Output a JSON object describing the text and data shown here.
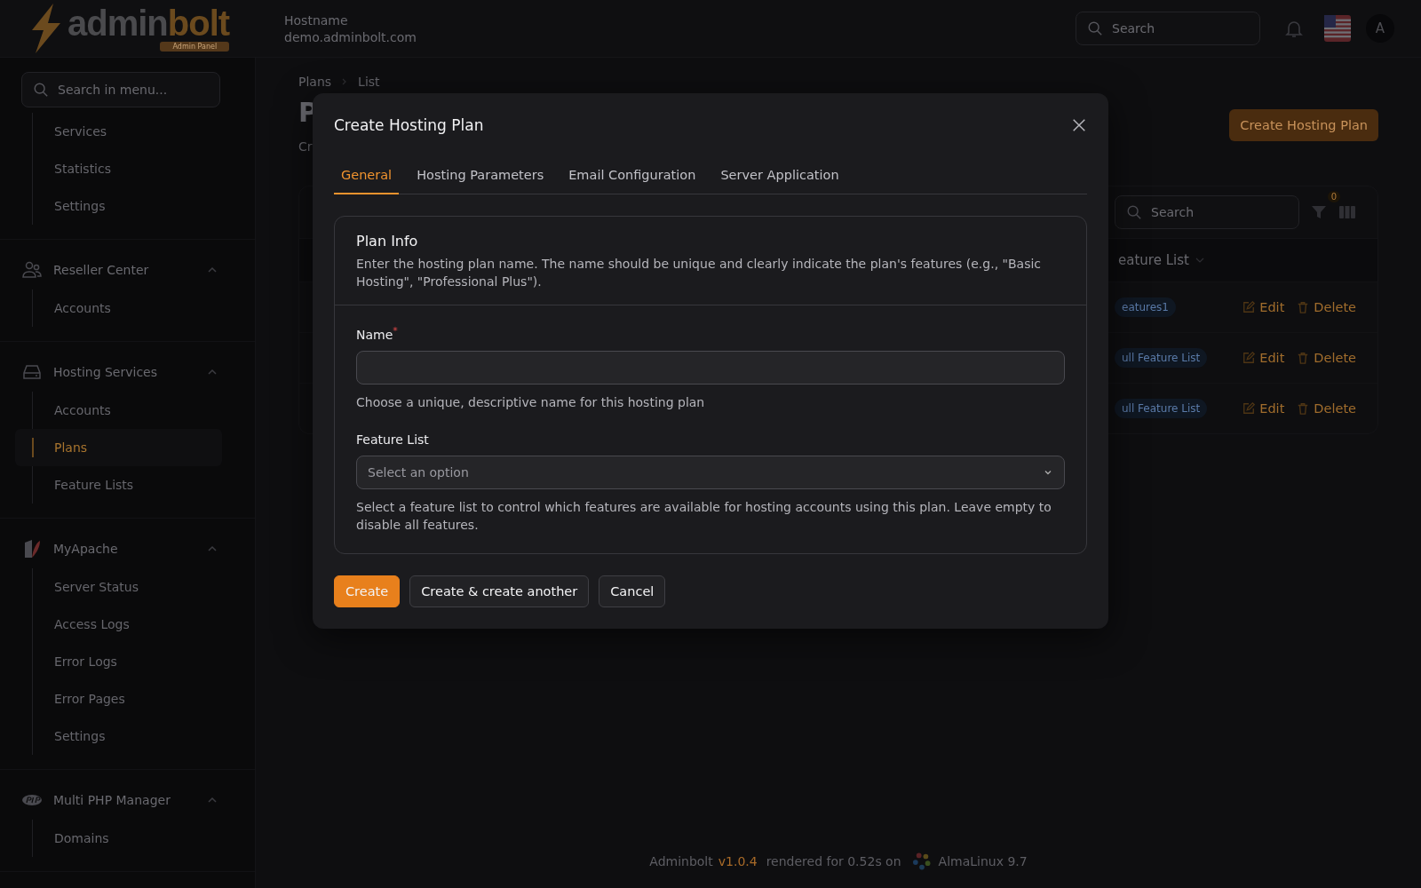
{
  "header": {
    "logo_main": "admin",
    "logo_accent": "bolt",
    "logo_badge": "Admin Panel",
    "hostname_label": "Hostname",
    "hostname": "demo.adminbolt.com",
    "search": {
      "placeholder": "Search"
    },
    "avatar": "A"
  },
  "sidebar": {
    "search": {
      "placeholder": "Search in menu..."
    },
    "groups": [
      {
        "items": [
          {
            "label": "Services",
            "selected": false
          },
          {
            "label": "Statistics",
            "selected": false
          },
          {
            "label": "Settings",
            "selected": false
          }
        ]
      },
      {
        "title": "Reseller Center",
        "expanded": true,
        "items": [
          {
            "label": "Accounts",
            "selected": false
          }
        ]
      },
      {
        "title": "Hosting Services",
        "expanded": true,
        "items": [
          {
            "label": "Accounts",
            "selected": false
          },
          {
            "label": "Plans",
            "selected": true
          },
          {
            "label": "Feature Lists",
            "selected": false
          }
        ]
      },
      {
        "title": "MyApache",
        "expanded": true,
        "items": [
          {
            "label": "Server Status",
            "selected": false
          },
          {
            "label": "Access Logs",
            "selected": false
          },
          {
            "label": "Error Logs",
            "selected": false
          },
          {
            "label": "Error Pages",
            "selected": false
          },
          {
            "label": "Settings",
            "selected": false
          }
        ]
      },
      {
        "title": "Multi PHP Manager",
        "expanded": true,
        "items": [
          {
            "label": "Domains",
            "selected": false
          }
        ]
      }
    ]
  },
  "page": {
    "breadcrumb": [
      "Plans",
      "List"
    ],
    "heading": "P",
    "subtitle": "Cr",
    "create_button": "Create Hosting Plan",
    "table": {
      "search": {
        "placeholder": "Search"
      },
      "filter_count": "0",
      "column": "eature List",
      "rows": [
        {
          "feature_list": "eatures1",
          "edit": "Edit",
          "delete": "Delete"
        },
        {
          "feature_list": "ull Feature List",
          "edit": "Edit",
          "delete": "Delete"
        },
        {
          "feature_list": "ull Feature List",
          "edit": "Edit",
          "delete": "Delete"
        }
      ]
    }
  },
  "modal": {
    "title": "Create Hosting Plan",
    "tabs": [
      {
        "label": "General",
        "selected": true
      },
      {
        "label": "Hosting Parameters",
        "selected": false
      },
      {
        "label": "Email Configuration",
        "selected": false
      },
      {
        "label": "Server Application",
        "selected": false
      }
    ],
    "section": {
      "title": "Plan Info",
      "description": "Enter the hosting plan name. The name should be unique and clearly indicate the plan's features (e.g., \"Basic Hosting\", \"Professional Plus\")."
    },
    "fields": [
      {
        "kind": "text",
        "label": "Name",
        "required_mark": "*",
        "help": "Choose a unique, descriptive name for this hosting plan"
      },
      {
        "kind": "select",
        "label": "Feature List",
        "placeholder": "Select an option",
        "help": "Select a feature list to control which features are available for hosting accounts using this plan. Leave empty to disable all features."
      }
    ],
    "buttons": [
      {
        "label": "Create",
        "kind": "primary"
      },
      {
        "label": "Create & create another",
        "kind": "secondary"
      },
      {
        "label": "Cancel",
        "kind": "secondary"
      }
    ]
  },
  "footer": {
    "product": "Adminbolt",
    "version": "v1.0.4",
    "rendered": "rendered for 0.52s on",
    "os": "AlmaLinux 9.7"
  }
}
